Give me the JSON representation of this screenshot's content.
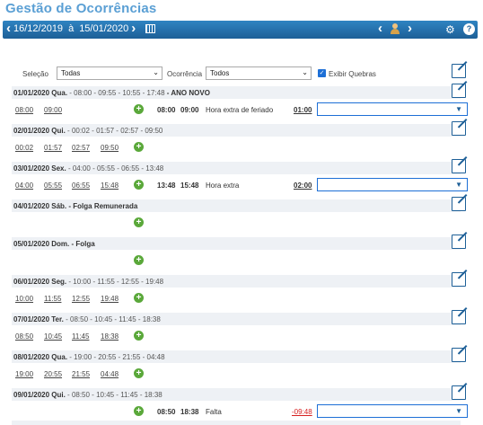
{
  "page_title": "Gestão de Ocorrências",
  "header": {
    "date_start": "16/12/2019",
    "separator": "à",
    "date_end": "15/01/2020"
  },
  "filters": {
    "selecao_label": "Seleção",
    "selecao_value": "Todas",
    "ocorrencia_label": "Ocorrência",
    "ocorrencia_value": "Todos",
    "exibir_quebras_label": "Exibir Quebras",
    "exibir_quebras_checked": true
  },
  "days": [
    {
      "date": "01/01/2020 Qua.",
      "times": "- 08:00 - 09:55 - 10:55 - 17:48",
      "note": "- ANO NOVO",
      "marks": [
        "08:00",
        "09:00"
      ],
      "occ_start": "08:00",
      "occ_end": "09:00",
      "occ_desc": "Hora extra de feriado",
      "occ_amount": "01:00",
      "negative": false
    },
    {
      "date": "02/01/2020 Qui.",
      "times": "- 00:02 - 01:57 - 02:57 - 09:50",
      "note": "",
      "marks": [
        "00:02",
        "01:57",
        "02:57",
        "09:50"
      ],
      "occ_start": "",
      "occ_end": "",
      "occ_desc": "",
      "occ_amount": "",
      "negative": false
    },
    {
      "date": "03/01/2020 Sex.",
      "times": "- 04:00 - 05:55 - 06:55 - 13:48",
      "note": "",
      "marks": [
        "04:00",
        "05:55",
        "06:55",
        "15:48"
      ],
      "occ_start": "13:48",
      "occ_end": "15:48",
      "occ_desc": "Hora extra",
      "occ_amount": "02:00",
      "negative": false
    },
    {
      "date": "04/01/2020 Sáb.",
      "times": "",
      "note": "- Folga Remunerada",
      "marks": [],
      "occ_start": "",
      "occ_end": "",
      "occ_desc": "",
      "occ_amount": "",
      "negative": false
    },
    {
      "date": "05/01/2020 Dom.",
      "times": "",
      "note": "- Folga",
      "marks": [],
      "occ_start": "",
      "occ_end": "",
      "occ_desc": "",
      "occ_amount": "",
      "negative": false
    },
    {
      "date": "06/01/2020 Seg.",
      "times": "- 10:00 - 11:55 - 12:55 - 19:48",
      "note": "",
      "marks": [
        "10:00",
        "11:55",
        "12:55",
        "19:48"
      ],
      "occ_start": "",
      "occ_end": "",
      "occ_desc": "",
      "occ_amount": "",
      "negative": false
    },
    {
      "date": "07/01/2020 Ter.",
      "times": "- 08:50 - 10:45 - 11:45 - 18:38",
      "note": "",
      "marks": [
        "08:50",
        "10:45",
        "11:45",
        "18:38"
      ],
      "occ_start": "",
      "occ_end": "",
      "occ_desc": "",
      "occ_amount": "",
      "negative": false
    },
    {
      "date": "08/01/2020 Qua.",
      "times": "- 19:00 - 20:55 - 21:55 - 04:48",
      "note": "",
      "marks": [
        "19:00",
        "20:55",
        "21:55",
        "04:48"
      ],
      "occ_start": "",
      "occ_end": "",
      "occ_desc": "",
      "occ_amount": "",
      "negative": false
    },
    {
      "date": "09/01/2020 Qui.",
      "times": "- 08:50 - 10:45 - 11:45 - 18:38",
      "note": "",
      "marks": [],
      "occ_start": "08:50",
      "occ_end": "18:38",
      "occ_desc": "Falta",
      "occ_amount": "-09:48",
      "negative": true
    }
  ]
}
